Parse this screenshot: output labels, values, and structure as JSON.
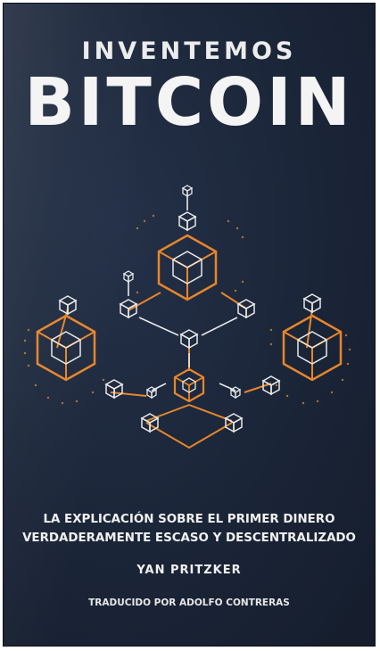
{
  "cover": {
    "pre_title": "INVENTEMOS",
    "title": "BITCOIN",
    "tagline_line1": "LA EXPLICACIÓN SOBRE EL PRIMER DINERO",
    "tagline_line2": "VERDADERAMENTE ESCASO Y DESCENTRALIZADO",
    "author": "YAN PRITZKER",
    "translator": "TRADUCIDO POR ADOLFO CONTRERAS"
  },
  "colors": {
    "background": "#1b2538",
    "accent_orange": "#e8862a",
    "line_white": "#e8e8e8",
    "text": "#f0f0f0"
  },
  "illustration": {
    "icon": "blockchain-cubes-network-icon"
  }
}
